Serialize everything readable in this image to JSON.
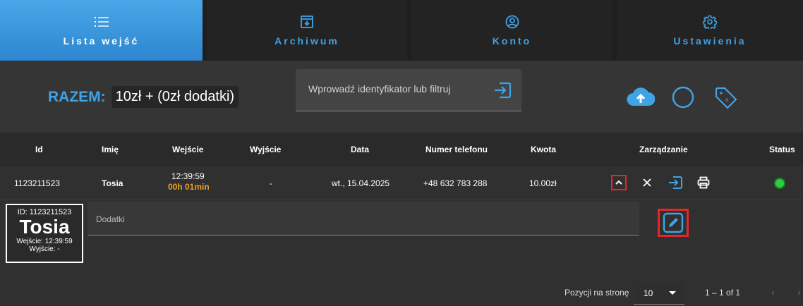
{
  "nav": {
    "tabs": [
      {
        "label": "Lista wejść",
        "icon": "list-icon"
      },
      {
        "label": "Archiwum",
        "icon": "archive-icon"
      },
      {
        "label": "Konto",
        "icon": "account-icon"
      },
      {
        "label": "Ustawienia",
        "icon": "settings-icon"
      }
    ]
  },
  "summary": {
    "label": "RAZEM:",
    "value": "10zł + (0zł dodatki)"
  },
  "search": {
    "placeholder": "Wprowadź identyfikator lub filtruj"
  },
  "table": {
    "headers": {
      "id": "Id",
      "name": "Imię",
      "entry": "Wejście",
      "exit": "Wyjście",
      "date": "Data",
      "phone": "Numer telefonu",
      "amount": "Kwota",
      "manage": "Zarządzanie",
      "status": "Status"
    },
    "row": {
      "id": "1123211523",
      "name": "Tosia",
      "entry_time": "12:39:59",
      "duration": "00h 01min",
      "exit": "-",
      "date": "wt., 15.04.2025",
      "phone": "+48 632 783 288",
      "amount": "10.00zł",
      "status_color": "#2ecc40"
    }
  },
  "detail": {
    "card_id": "ID: 1123211523",
    "card_name": "Tosia",
    "card_entry": "Wejście: 12:39:59",
    "card_exit": "Wyjście: -",
    "addons_placeholder": "Dodatki"
  },
  "pagination": {
    "label": "Pozycji na stronę",
    "per_page": "10",
    "range": "1 – 1 of 1"
  },
  "colors": {
    "accent": "#3fa3e6",
    "highlight": "#e0282e",
    "warning": "#f0a020"
  }
}
